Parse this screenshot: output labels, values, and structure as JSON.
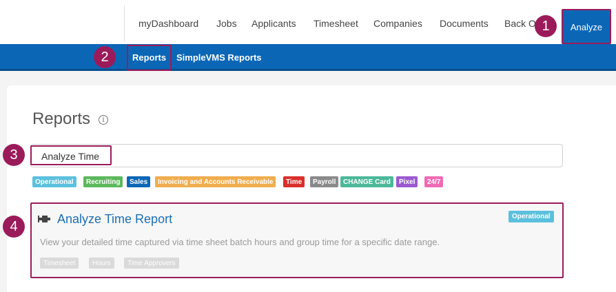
{
  "nav": {
    "items": [
      "myDashboard",
      "Jobs",
      "Applicants",
      "Timesheet",
      "Companies",
      "Documents",
      "Back O"
    ],
    "active": "Analyze"
  },
  "subnav": {
    "items": [
      "Reports",
      "SimpleVMS Reports"
    ]
  },
  "page": {
    "title": "Reports",
    "info_icon": "i"
  },
  "search": {
    "value": "Analyze Time"
  },
  "tags": [
    {
      "label": "Operational",
      "color": "#5bc0de"
    },
    {
      "label": "Recruiting",
      "color": "#5cb85c"
    },
    {
      "label": "Sales",
      "color": "#0b67b6"
    },
    {
      "label": "Invoicing and Accounts Receivable",
      "color": "#f0ad4e"
    },
    {
      "label": "Time",
      "color": "#d9302b"
    },
    {
      "label": "Payroll",
      "color": "#8a8a8a"
    },
    {
      "label": "CHANGE Card",
      "color": "#4bb89a"
    },
    {
      "label": "Pixel",
      "color": "#9b59d0"
    },
    {
      "label": "24/7",
      "color": "#f06bb5"
    }
  ],
  "report": {
    "icon": "pushpin-icon",
    "title": "Analyze Time Report",
    "badge": "Operational",
    "description": "View your detailed time captured via time sheet batch hours and group time for a specific date range.",
    "tags": [
      "Timesheet",
      "Hours",
      "Time Approvers"
    ]
  },
  "annotations": [
    "1",
    "2",
    "3",
    "4"
  ],
  "colors": {
    "brand_blue": "#0b67b6",
    "annotation": "#9b1b5a"
  }
}
